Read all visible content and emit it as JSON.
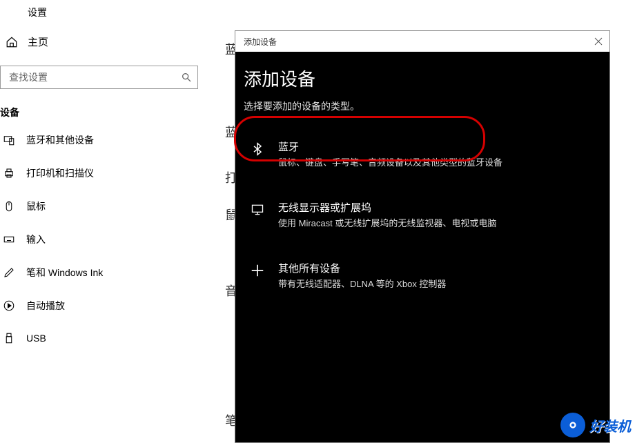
{
  "settings": {
    "title": "设置",
    "home": "主页",
    "search_placeholder": "查找设置",
    "category": "设备",
    "nav": [
      {
        "label": "蓝牙和其他设备"
      },
      {
        "label": "打印机和扫描仪"
      },
      {
        "label": "鼠标"
      },
      {
        "label": "输入"
      },
      {
        "label": "笔和 Windows Ink"
      },
      {
        "label": "自动播放"
      },
      {
        "label": "USB"
      }
    ]
  },
  "bg_letters": [
    "蓝",
    "打",
    "鼠",
    "音",
    "笔"
  ],
  "dialog": {
    "titlebar": "添加设备",
    "heading": "添加设备",
    "sub": "选择要添加的设备的类型。",
    "options": [
      {
        "title": "蓝牙",
        "desc": "鼠标、键盘、手写笔、音频设备以及其他类型的蓝牙设备"
      },
      {
        "title": "无线显示器或扩展坞",
        "desc": "使用 Miracast 或无线扩展坞的无线监视器、电视或电脑"
      },
      {
        "title": "其他所有设备",
        "desc": "带有无线适配器、DLNA 等的 Xbox 控制器"
      }
    ]
  },
  "watermark": "好装机"
}
